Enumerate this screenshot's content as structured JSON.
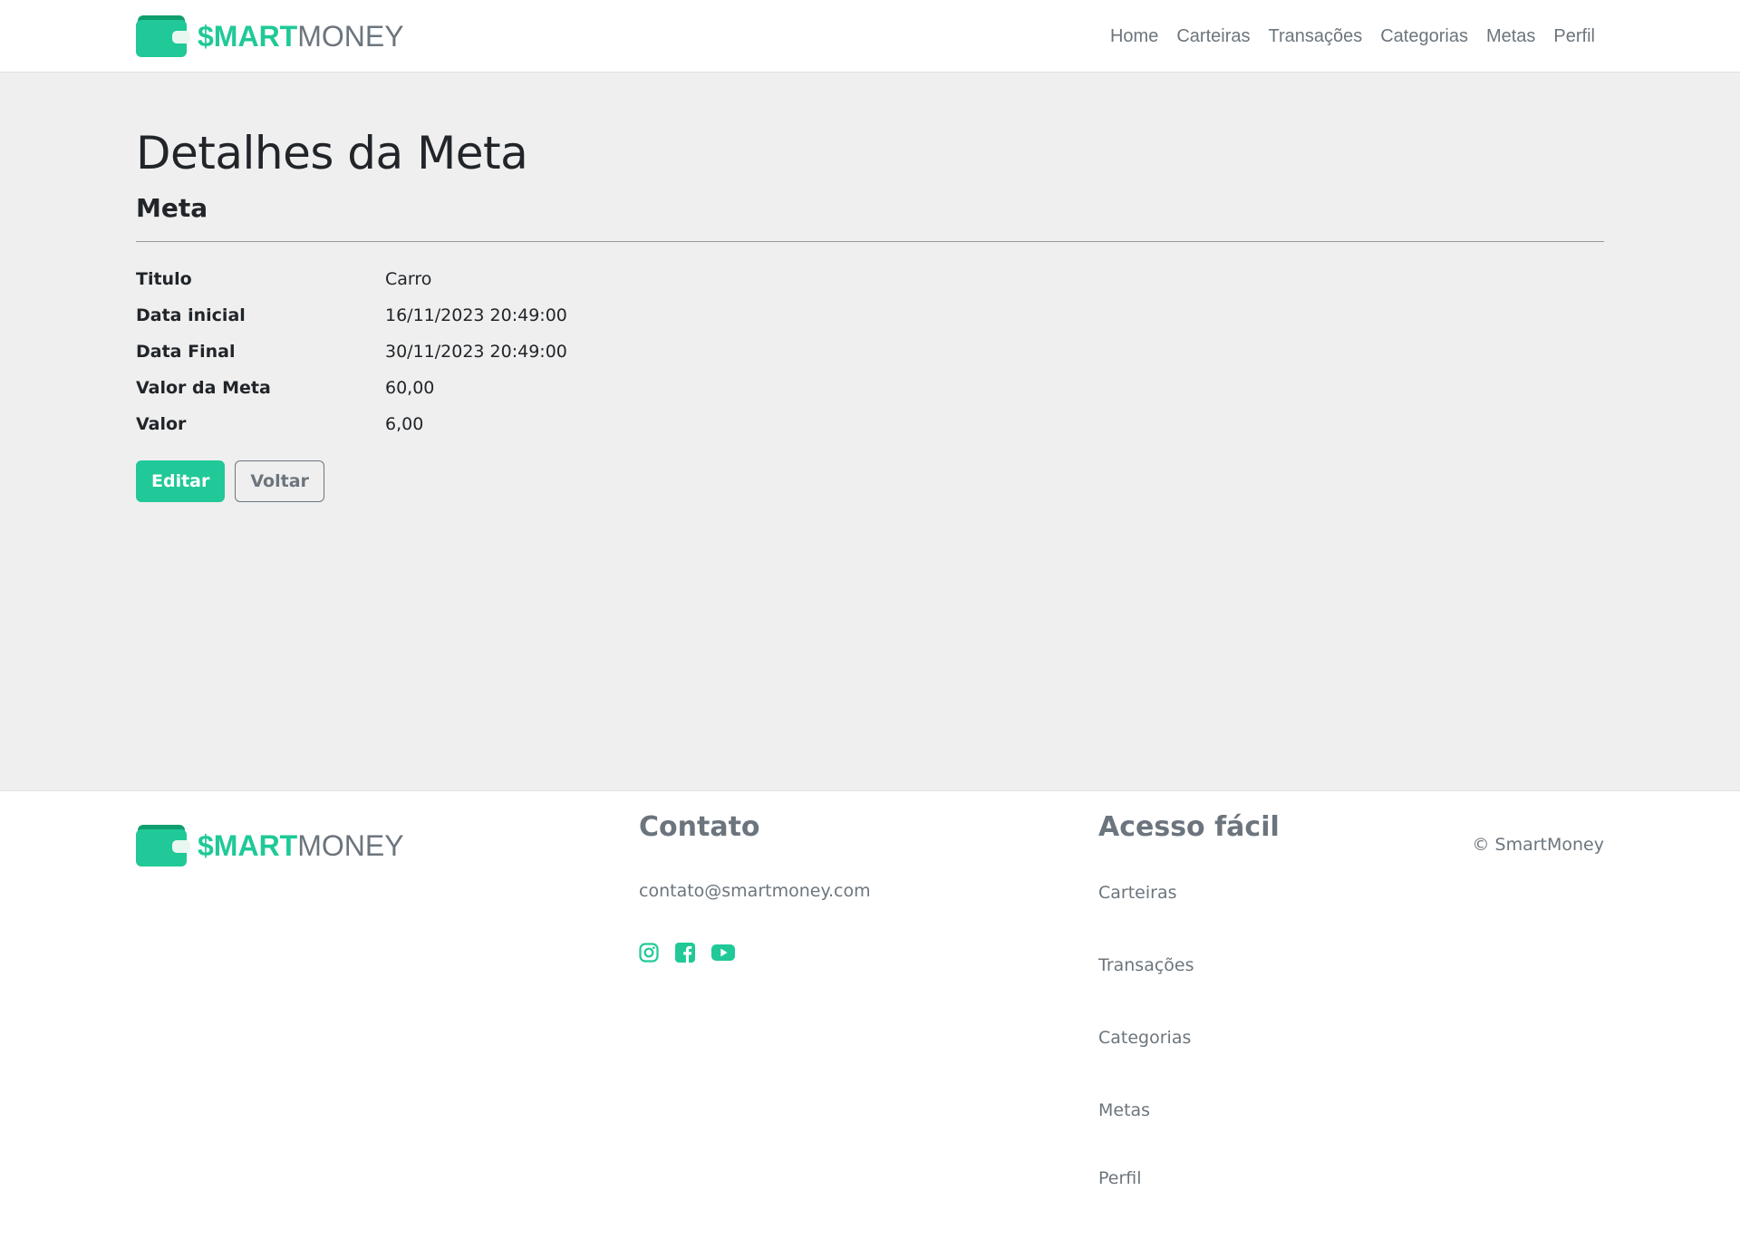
{
  "brand": {
    "name_bold": "$MART",
    "name_light": "MONEY",
    "primary_color": "#20c997",
    "secondary_color": "#6c757d",
    "logo_icon": "wallet-icon"
  },
  "nav": {
    "items": [
      {
        "label": "Home"
      },
      {
        "label": "Carteiras"
      },
      {
        "label": "Transações"
      },
      {
        "label": "Categorias"
      },
      {
        "label": "Metas"
      },
      {
        "label": "Perfil"
      }
    ]
  },
  "main": {
    "title": "Detalhes da Meta",
    "subtitle": "Meta",
    "details": [
      {
        "label": "Titulo",
        "value": "Carro"
      },
      {
        "label": "Data inicial",
        "value": "16/11/2023 20:49:00"
      },
      {
        "label": "Data Final",
        "value": "30/11/2023 20:49:00"
      },
      {
        "label": "Valor da Meta",
        "value": "60,00"
      },
      {
        "label": "Valor",
        "value": "6,00"
      }
    ],
    "edit_label": "Editar",
    "back_label": "Voltar"
  },
  "footer": {
    "contact_heading": "Contato",
    "email": "contato@smartmoney.com",
    "socials": [
      {
        "icon": "instagram-icon"
      },
      {
        "icon": "facebook-icon"
      },
      {
        "icon": "youtube-icon"
      }
    ],
    "access_heading": "Acesso fácil",
    "links": [
      {
        "label": "Carteiras"
      },
      {
        "label": "Transações"
      },
      {
        "label": "Categorias"
      },
      {
        "label": "Metas"
      },
      {
        "label": "Perfil"
      }
    ],
    "copyright": "© SmartMoney"
  }
}
